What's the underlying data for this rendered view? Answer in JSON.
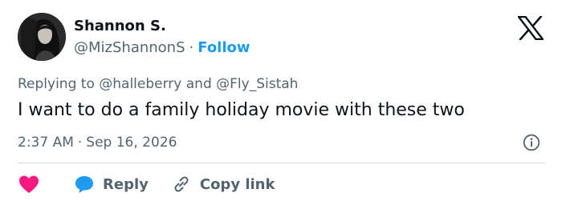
{
  "author": {
    "display_name": "Shannon S.",
    "handle": "@MizShannonS",
    "separator": "·",
    "follow_label": "Follow"
  },
  "reply_context": {
    "prefix": "Replying to ",
    "mention_1": "@halleberry",
    "conjunction": " and ",
    "mention_2": "@Fly_Sistah"
  },
  "tweet": {
    "text": "I want to do a family holiday movie with these two",
    "time": "2:37 AM",
    "separator": "·",
    "date": "Sep 16, 2026"
  },
  "actions": {
    "like_icon": "heart-icon",
    "reply_label": "Reply",
    "copy_link_label": "Copy link"
  },
  "icons": {
    "platform_logo": "x-logo-icon",
    "info": "info-icon",
    "reply": "speech-bubble-icon",
    "copy": "link-icon"
  },
  "colors": {
    "accent": "#1d9bf0",
    "like": "#f91880",
    "text_primary": "#0f1419",
    "text_secondary": "#536471",
    "divider": "#cfd9de"
  }
}
